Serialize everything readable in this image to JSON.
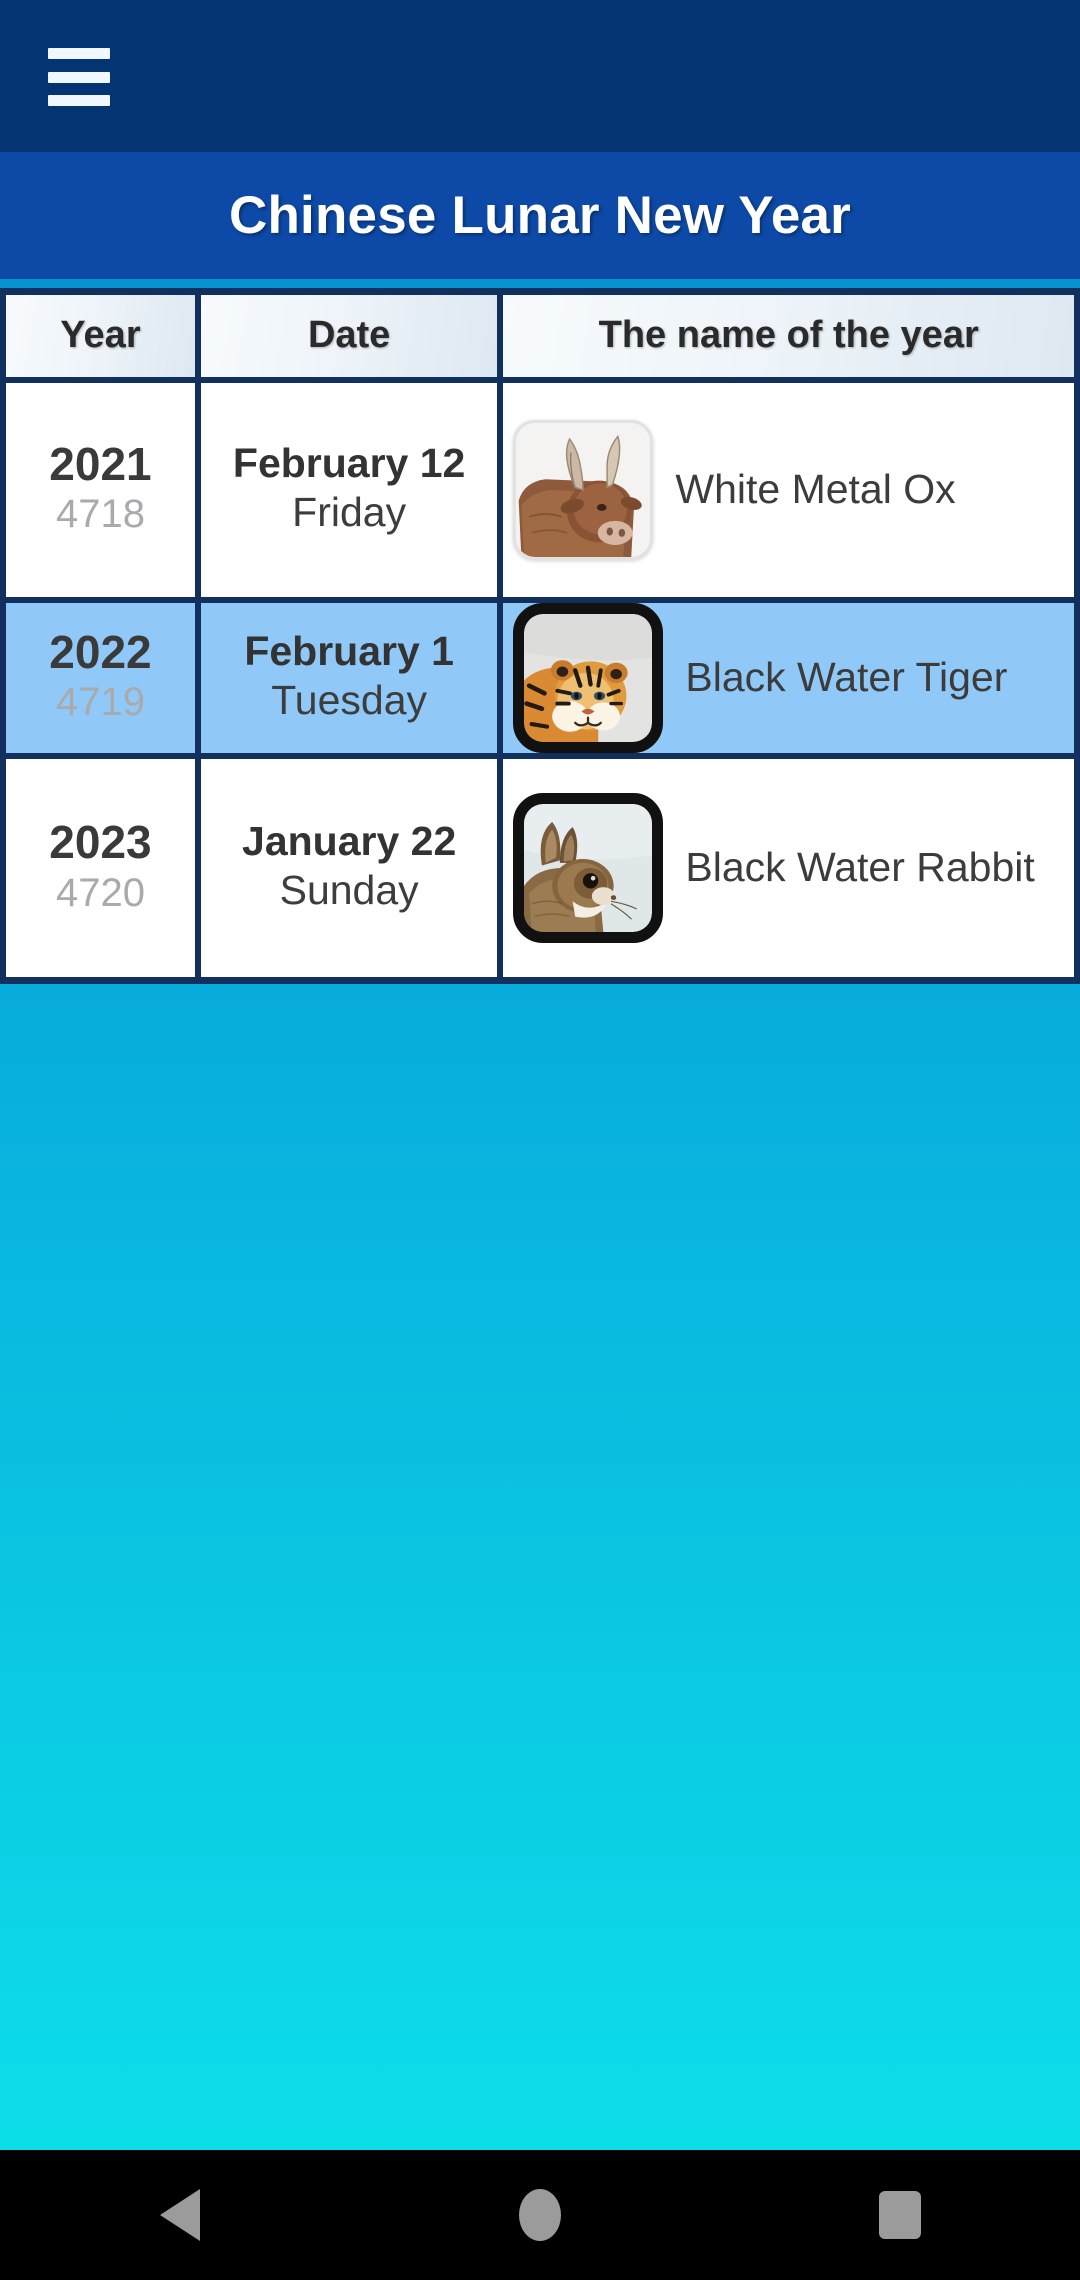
{
  "topbar": {
    "menu_icon": "hamburger-menu-icon",
    "background_color": "#043472"
  },
  "header": {
    "title": "Chinese Lunar New Year",
    "background_color": "#0d4aa8",
    "title_color": "#ffffff"
  },
  "table": {
    "columns": [
      "Year",
      "Date",
      "The name of the year"
    ],
    "border_color": "#12305e",
    "highlight_color": "#90c9f8",
    "rows": [
      {
        "year": "2021",
        "lunar_year": "4718",
        "date": "February 12",
        "weekday": "Friday",
        "name": "White Metal Ox",
        "animal_icon": "ox-icon",
        "frame": "plain",
        "highlighted": false
      },
      {
        "year": "2022",
        "lunar_year": "4719",
        "date": "February 1",
        "weekday": "Tuesday",
        "name": "Black Water Tiger",
        "animal_icon": "tiger-icon",
        "frame": "framed",
        "highlighted": true
      },
      {
        "year": "2023",
        "lunar_year": "4720",
        "date": "January 22",
        "weekday": "Sunday",
        "name": "Black Water Rabbit",
        "animal_icon": "rabbit-icon",
        "frame": "framed",
        "highlighted": false
      }
    ]
  },
  "background": {
    "gradient_top": "#0689cd",
    "gradient_bottom": "#0ce4ea"
  },
  "navbar": {
    "background_color": "#000000",
    "buttons": [
      "back-icon",
      "home-icon",
      "recents-icon"
    ]
  }
}
